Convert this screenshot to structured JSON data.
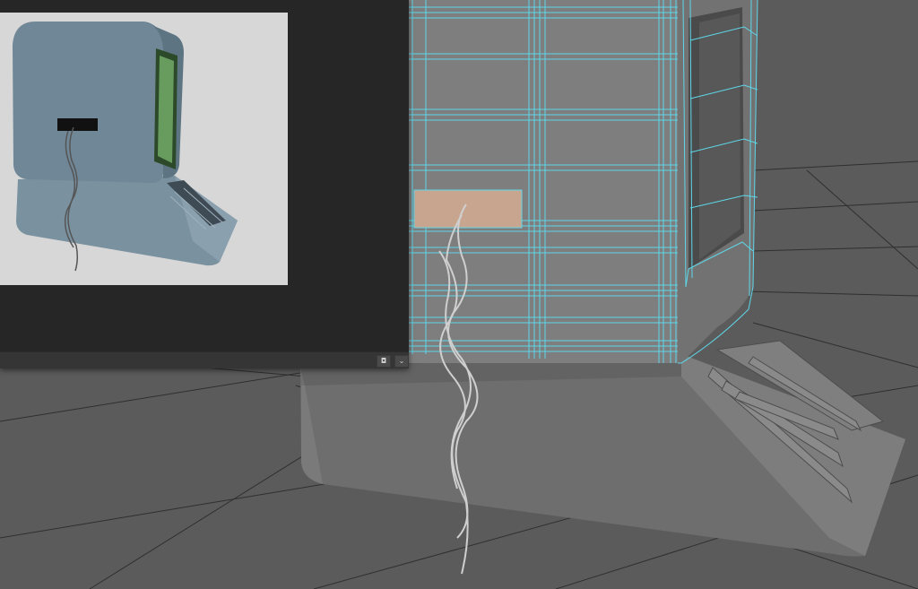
{
  "viewport": {
    "background": "#5b5b5b",
    "grid_color": "#2f2f2f",
    "wireframe_color": "#5fd6e8",
    "label_color": "#c8a58f"
  },
  "render_panel": {
    "background": "#262626",
    "render_background": "#d7d7d7",
    "model_color": "#7a91a0",
    "screen_color": "#2c4a2a",
    "screen_glow": "#9be08a",
    "label_color": "#111111"
  },
  "panel_footer": {
    "snapshot_icon": "camera-icon",
    "snapshot_glyph": "◘",
    "dropdown_icon": "chevron-down-icon",
    "dropdown_glyph": "⌄"
  }
}
